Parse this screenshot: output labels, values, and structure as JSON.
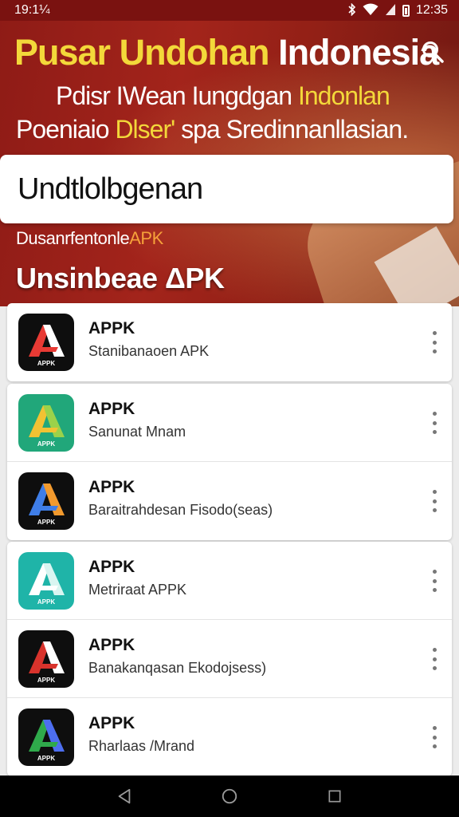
{
  "status_bar": {
    "left_text": "19:1¼",
    "time": "12:35"
  },
  "hero": {
    "title_yellow": "Pusar Undohan",
    "title_white": "Indonesia",
    "line1_white": "Pdisr IWean Iungdgan",
    "line1_yellow": "Indonlan",
    "line2_white_a": "Poeniaio",
    "line2_yellow": "Dlser'",
    "line2_white_b": "spa Sredinnanllasian.",
    "search_value": "Undtlolbgenan",
    "sub_white": "Dusanrfentonle",
    "sub_orange": "APK",
    "section_title": "Unsinbeae ΔPK"
  },
  "lists": [
    {
      "items": [
        {
          "name": "APPK",
          "desc": "Stanibanaoen APK",
          "icon": "app-logo-red-white",
          "bg": "#0e0e0e",
          "colors": [
            "#e83a34",
            "#ffffff"
          ]
        }
      ]
    },
    {
      "items": [
        {
          "name": "APPK",
          "desc": "Sanunat Mnam",
          "icon": "app-logo-yellow-green",
          "bg": "#21a77a",
          "colors": [
            "#f2c233",
            "#9bd24a"
          ]
        },
        {
          "name": "APPK",
          "desc": "Baraitrahdesan Fisodo(seas)",
          "icon": "app-logo-blue-orange",
          "bg": "#0e0e0e",
          "colors": [
            "#3f7ee8",
            "#f29a2e"
          ]
        }
      ]
    },
    {
      "items": [
        {
          "name": "APPK",
          "desc": "Metriraat APPK",
          "icon": "app-logo-white-teal",
          "bg": "#1fb4a8",
          "colors": [
            "#ffffff",
            "#d9f5f1"
          ]
        },
        {
          "name": "APPK",
          "desc": "Banakanqasan Ekodojsess)",
          "icon": "app-logo-red-white",
          "bg": "#0e0e0e",
          "colors": [
            "#d8332c",
            "#ffffff"
          ]
        },
        {
          "name": "APPK",
          "desc": "Rharlaas /Mrand",
          "icon": "app-logo-green-blue",
          "bg": "#0e0e0e",
          "colors": [
            "#2faa4b",
            "#4d6ef0"
          ]
        }
      ]
    }
  ],
  "icon_label": "APPK",
  "nav": {
    "back": "back-icon",
    "home": "home-icon",
    "recents": "recents-icon"
  }
}
